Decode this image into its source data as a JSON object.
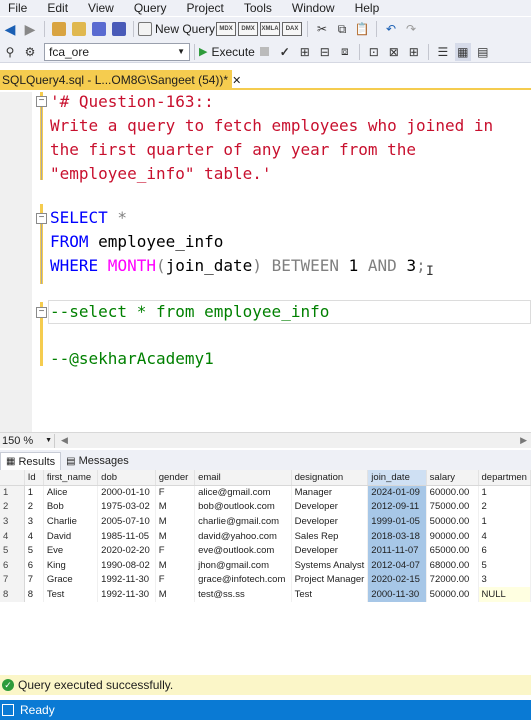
{
  "menu": [
    "File",
    "Edit",
    "View",
    "Query",
    "Project",
    "Tools",
    "Window",
    "Help"
  ],
  "toolbar": {
    "new_query_label": "New Query",
    "tiny_labels": [
      "MDX",
      "DMX",
      "XMLA",
      "DAX"
    ],
    "database": "fca_ore",
    "execute_label": "Execute"
  },
  "tab": {
    "title": "SQLQuery4.sql - L...OM8G\\Sangeet (54))*"
  },
  "editor": {
    "lines": {
      "l1": "'# Question-163::",
      "l2": "Write a query to fetch employees who joined in",
      "l3": "the first quarter of any year from the",
      "l4": "\"employee_info\" table.'",
      "select_kw": "SELECT",
      "star": " *",
      "from_kw": "FROM",
      "from_tbl": " employee_info",
      "where_kw": "WHERE",
      "month_fn": " MONTH",
      "paren_open": "(",
      "col": "join_date",
      "paren_close": ")",
      "between_kw": " BETWEEN",
      "num1": " 1",
      "and_kw": " AND",
      "num3": " 3",
      "semi": ";",
      "comment1": "--select * from employee_info",
      "comment2": "--@sekharAcademy1"
    }
  },
  "zoom": "150 %",
  "results_tabs": {
    "results": "Results",
    "messages": "Messages"
  },
  "grid": {
    "columns": [
      "Id",
      "first_name",
      "dob",
      "gender",
      "email",
      "designation",
      "join_date",
      "salary",
      "departmen"
    ],
    "rows": [
      [
        "1",
        "1",
        "Alice",
        "2000-01-10",
        "F",
        "alice@gmail.com",
        "Manager",
        "2024-01-09",
        "60000.00",
        "1"
      ],
      [
        "2",
        "2",
        "Bob",
        "1975-03-02",
        "M",
        "bob@outlook.com",
        "Developer",
        "2012-09-11",
        "75000.00",
        "2"
      ],
      [
        "3",
        "3",
        "Charlie",
        "2005-07-10",
        "M",
        "charlie@gmail.com",
        "Developer",
        "1999-01-05",
        "50000.00",
        "1"
      ],
      [
        "4",
        "4",
        "David",
        "1985-11-05",
        "M",
        "david@yahoo.com",
        "Sales Rep",
        "2018-03-18",
        "90000.00",
        "4"
      ],
      [
        "5",
        "5",
        "Eve",
        "2020-02-20",
        "F",
        "eve@outlook.com",
        "Developer",
        "2011-11-07",
        "65000.00",
        "6"
      ],
      [
        "6",
        "6",
        "King",
        "1990-08-02",
        "M",
        "jhon@gmail.com",
        "Systems Analyst",
        "2012-04-07",
        "68000.00",
        "5"
      ],
      [
        "7",
        "7",
        "Grace",
        "1992-11-30",
        "F",
        "grace@infotech.com",
        "Project Manager",
        "2020-02-15",
        "72000.00",
        "3"
      ],
      [
        "8",
        "8",
        "Test",
        "1992-11-30",
        "M",
        "test@ss.ss",
        "Test",
        "2000-11-30",
        "50000.00",
        "NULL"
      ]
    ]
  },
  "status": {
    "query_message": "Query executed successfully.",
    "ready": "Ready"
  }
}
